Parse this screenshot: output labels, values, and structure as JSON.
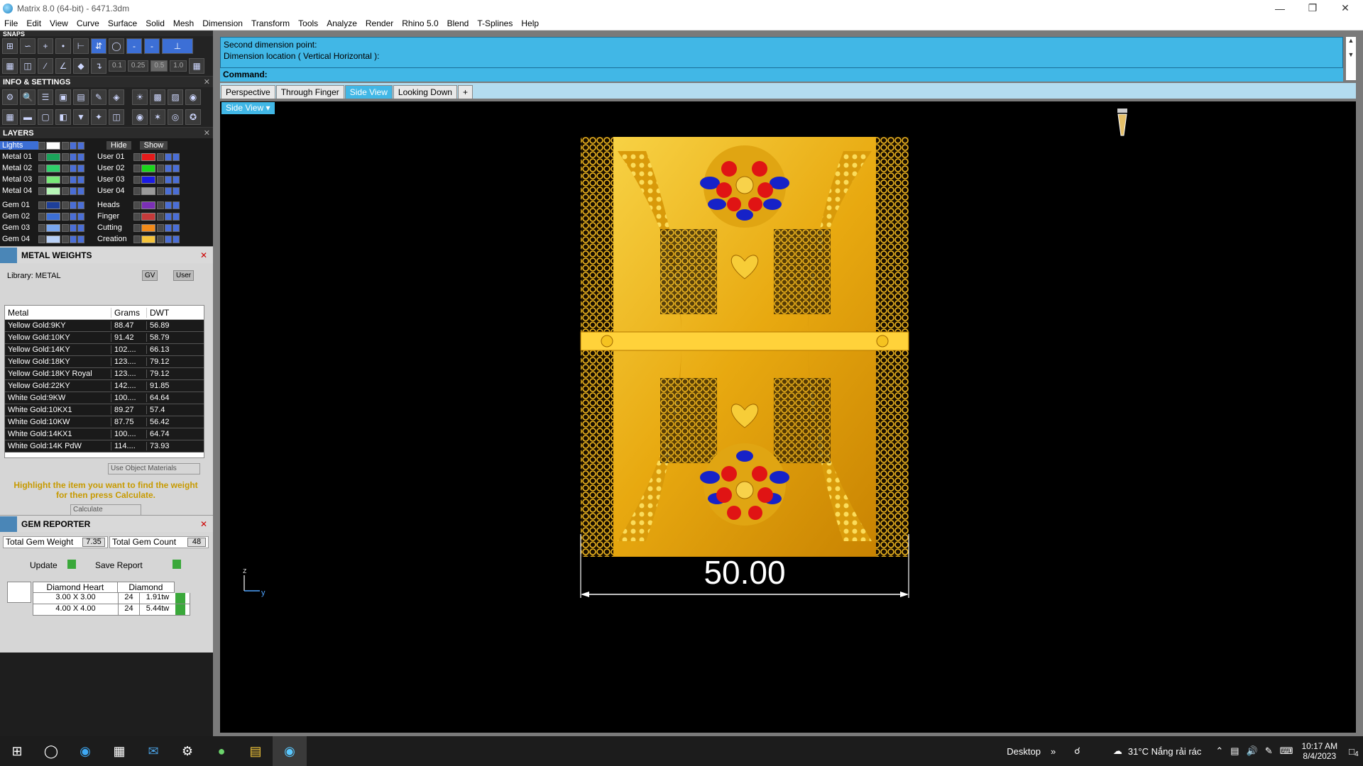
{
  "window": {
    "title": "Matrix 8.0 (64-bit) - 6471.3dm"
  },
  "menu": [
    "File",
    "Edit",
    "View",
    "Curve",
    "Surface",
    "Solid",
    "Mesh",
    "Dimension",
    "Transform",
    "Tools",
    "Analyze",
    "Render",
    "Rhino 5.0",
    "Blend",
    "T-Splines",
    "Help"
  ],
  "snaps": {
    "label": "SNAPS",
    "values": [
      "0.1",
      "0.25",
      "0.5",
      "1.0"
    ]
  },
  "info_settings": {
    "label": "INFO & SETTINGS"
  },
  "layers": {
    "label": "LAYERS",
    "lights": "Lights",
    "hide": "Hide",
    "show": "Show",
    "left": [
      {
        "name": "Metal 01",
        "color": "#1aa35a"
      },
      {
        "name": "Metal 02",
        "color": "#2fcf6a"
      },
      {
        "name": "Metal 03",
        "color": "#78e878"
      },
      {
        "name": "Metal 04",
        "color": "#b6f5b6"
      },
      {
        "name": "Gem 01",
        "color": "#1d3f9a"
      },
      {
        "name": "Gem 02",
        "color": "#3c6fd6"
      },
      {
        "name": "Gem 03",
        "color": "#79a6ee"
      },
      {
        "name": "Gem 04",
        "color": "#b8d0f7"
      }
    ],
    "right": [
      {
        "name": "User 01",
        "color": "#e41b1b"
      },
      {
        "name": "User 02",
        "color": "#1ad61a"
      },
      {
        "name": "User 03",
        "color": "#1a1ae4"
      },
      {
        "name": "User 04",
        "color": "#9a9a9a"
      },
      {
        "name": "Heads",
        "color": "#7b2fb5"
      },
      {
        "name": "Finger",
        "color": "#c43a3a"
      },
      {
        "name": "Cutting",
        "color": "#f08a1a"
      },
      {
        "name": "Creation",
        "color": "#f5c33a"
      }
    ]
  },
  "metal_weights": {
    "title": "METAL WEIGHTS",
    "library": "Library: METAL",
    "gv": "GV",
    "user": "User",
    "columns": [
      "Metal",
      "Grams",
      "DWT"
    ],
    "rows": [
      [
        "Yellow Gold:9KY",
        "88.47",
        "56.89"
      ],
      [
        "Yellow Gold:10KY",
        "91.42",
        "58.79"
      ],
      [
        "Yellow Gold:14KY",
        "102....",
        "66.13"
      ],
      [
        "Yellow Gold:18KY",
        "123....",
        "79.12"
      ],
      [
        "Yellow Gold:18KY Royal",
        "123....",
        "79.12"
      ],
      [
        "Yellow Gold:22KY",
        "142....",
        "91.85"
      ],
      [
        "White Gold:9KW",
        "100....",
        "64.64"
      ],
      [
        "White Gold:10KX1",
        "89.27",
        "57.4"
      ],
      [
        "White Gold:10KW",
        "87.75",
        "56.42"
      ],
      [
        "White Gold:14KX1",
        "100....",
        "64.74"
      ],
      [
        "White Gold:14K PdW",
        "114....",
        "73.93"
      ]
    ],
    "use_object_materials": "Use Object Materials",
    "hint": "Highlight the item you want to find the weight for then press Calculate.",
    "calculate": "Calculate"
  },
  "gem_reporter": {
    "title": "GEM REPORTER",
    "total_weight_label": "Total Gem Weight",
    "total_weight": "7.35",
    "total_count_label": "Total Gem Count",
    "total_count": "48",
    "update": "Update",
    "save_report": "Save Report",
    "columns": [
      "Diamond Heart",
      "Diamond"
    ],
    "rows": [
      [
        "3.00 X 3.00",
        "24",
        "1.91tw"
      ],
      [
        "4.00 X 4.00",
        "24",
        "5.44tw"
      ]
    ]
  },
  "command": {
    "line1": "Second dimension point:",
    "line2": "Dimension location ( Vertical  Horizontal ):",
    "prompt": "Command:"
  },
  "view_tabs": [
    "Perspective",
    "Through Finger",
    "Side View",
    "Looking Down",
    "+"
  ],
  "active_view": "Side View",
  "viewport": {
    "dimension": "50.00",
    "axis_z": "z",
    "axis_y": "y"
  },
  "taskbar": {
    "desktop": "Desktop",
    "weather": "31°C  Nắng rải rác",
    "time": "10:17 AM",
    "date": "8/4/2023",
    "notifications": "4"
  }
}
